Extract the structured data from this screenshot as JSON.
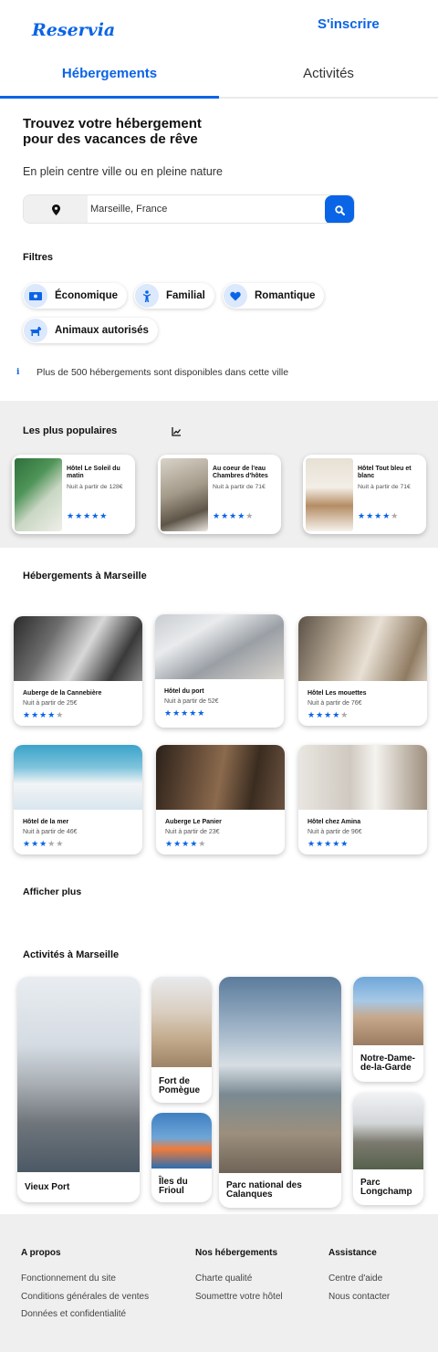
{
  "header": {
    "logo": "Reservia",
    "signup": "S'inscrire"
  },
  "tabs": [
    {
      "label": "Hébergements",
      "active": true
    },
    {
      "label": "Activités",
      "active": false
    }
  ],
  "hero": {
    "title_line1": "Trouvez votre hébergement",
    "title_line2": "pour des vacances de rêve",
    "subtitle": "En plein centre ville ou en pleine nature"
  },
  "search": {
    "value": "Marseille, France",
    "pin_icon": "map-pin-icon",
    "button_icon": "search-icon"
  },
  "filters": {
    "title": "Filtres",
    "items": [
      {
        "label": "Économique",
        "icon": "money-icon"
      },
      {
        "label": "Familial",
        "icon": "child-icon"
      },
      {
        "label": "Romantique",
        "icon": "heart-icon"
      },
      {
        "label": "Animaux autorisés",
        "icon": "dog-icon"
      }
    ]
  },
  "info": {
    "icon": "i",
    "text": "Plus de 500 hébergements sont disponibles dans cette ville"
  },
  "popular": {
    "title": "Les plus populaires",
    "trend_icon": "trend-icon",
    "items": [
      {
        "name": "Hôtel Le Soleil du matin",
        "price": "Nuit à partir de 128€",
        "rating": 5
      },
      {
        "name": "Au coeur de l'eau Chambres d'hôtes",
        "price": "Nuit à partir de 71€",
        "rating": 4
      },
      {
        "name": "Hôtel Tout bleu et blanc",
        "price": "Nuit à partir de 71€",
        "rating": 4
      }
    ]
  },
  "lodgings": {
    "title": "Hébergements à Marseille",
    "items": [
      {
        "name": "Auberge de la Cannebière",
        "price": "Nuit à partir de 25€",
        "rating": 4
      },
      {
        "name": "Hôtel du port",
        "price": "Nuit à partir de 52€",
        "rating": 5
      },
      {
        "name": "Hôtel Les mouettes",
        "price": "Nuit à partir de 76€",
        "rating": 4
      },
      {
        "name": "Hôtel de la mer",
        "price": "Nuit à partir de 46€",
        "rating": 3
      },
      {
        "name": "Auberge Le Panier",
        "price": "Nuit à partir de 23€",
        "rating": 4
      },
      {
        "name": "Hôtel chez Amina",
        "price": "Nuit à partir de 96€",
        "rating": 5
      }
    ],
    "show_more": "Afficher plus"
  },
  "activities": {
    "title": "Activités à Marseille",
    "items": [
      {
        "label": "Vieux Port"
      },
      {
        "label": "Fort de Pomègue"
      },
      {
        "label": "Îles du Frioul"
      },
      {
        "label": "Parc national des Calanques"
      },
      {
        "label": "Notre-Dame-de-la-Garde"
      },
      {
        "label": "Parc Longchamp"
      }
    ]
  },
  "footer": {
    "columns": [
      {
        "title": "A propos",
        "links": [
          "Fonctionnement du site",
          "Conditions générales de ventes",
          "Données et confidentialité"
        ]
      },
      {
        "title": "Nos hébergements",
        "links": [
          "Charte qualité",
          "Soumettre votre hôtel"
        ]
      },
      {
        "title": "Assistance",
        "links": [
          "Centre d'aide",
          "Nous contacter"
        ]
      }
    ]
  },
  "colors": {
    "accent": "#0a64e6",
    "star_off": "#aaaaaa",
    "band": "#efefef"
  }
}
